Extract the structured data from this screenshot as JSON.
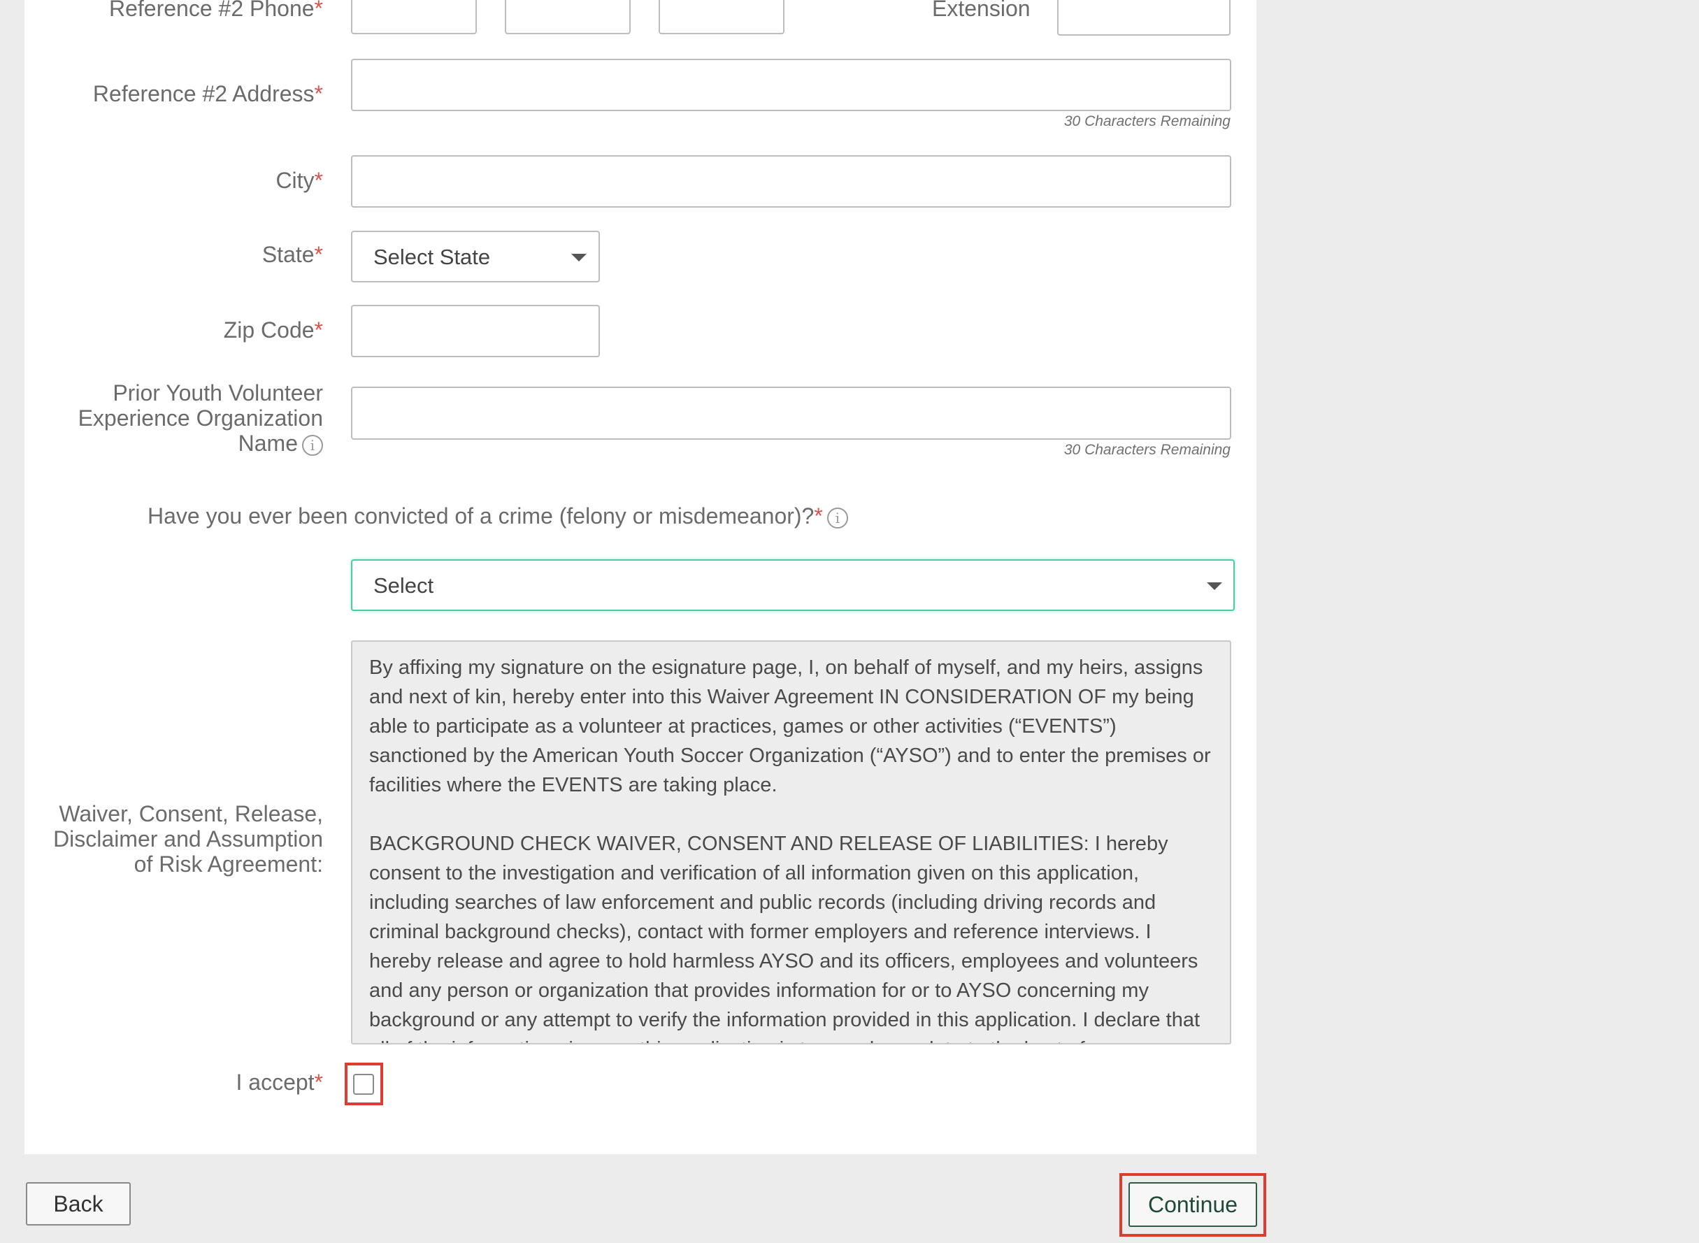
{
  "form": {
    "ref2_phone_label": "Reference #2 Phone",
    "extension_label": "Extension",
    "ref2_address_label": "Reference #2 Address",
    "ref2_address_remaining": "30 Characters Remaining",
    "city_label": "City",
    "state_label": "State",
    "state_selected": "Select State",
    "zip_label": "Zip Code",
    "prior_exp_label_1": "Prior Youth Volunteer",
    "prior_exp_label_2": "Experience Organization",
    "prior_exp_label_3": "Name",
    "prior_exp_remaining": "30 Characters Remaining",
    "crime_question": "Have you ever been convicted of a crime (felony or misdemeanor)?",
    "crime_selected": "Select",
    "waiver_label_1": "Waiver, Consent, Release,",
    "waiver_label_2": "Disclaimer and Assumption",
    "waiver_label_3": "of Risk Agreement:",
    "waiver_paragraphs": [
      "By affixing my signature on the esignature page, I, on behalf of myself, and my heirs, assigns and next of kin, hereby enter into this Waiver Agreement IN CONSIDERATION OF my being able to participate as a volunteer at practices, games or other activities (“EVENTS”) sanctioned by the American Youth Soccer Organization (“AYSO”) and to enter the premises or facilities where the EVENTS are taking place.",
      "BACKGROUND CHECK WAIVER, CONSENT AND RELEASE OF LIABILITIES: I hereby consent to the investigation and verification of all information given on this application, including searches of law enforcement and public records (including driving records and criminal background checks), contact with former employers and reference interviews. I hereby release and agree to hold harmless AYSO and its officers, employees and volunteers and any person or organization that provides information for or to AYSO concerning my background or any attempt to verify the information provided in this application. I declare that all of the information given on this application is true and complete to the best of"
    ],
    "accept_label": "I accept",
    "required_mark": "*",
    "info_glyph": "i"
  },
  "footer": {
    "back_label": "Back",
    "continue_label": "Continue"
  },
  "colors": {
    "required": "#d9534f",
    "focus_border": "#4cc9a6",
    "highlight": "#e03b2f",
    "continue_text": "#1f4a36"
  }
}
